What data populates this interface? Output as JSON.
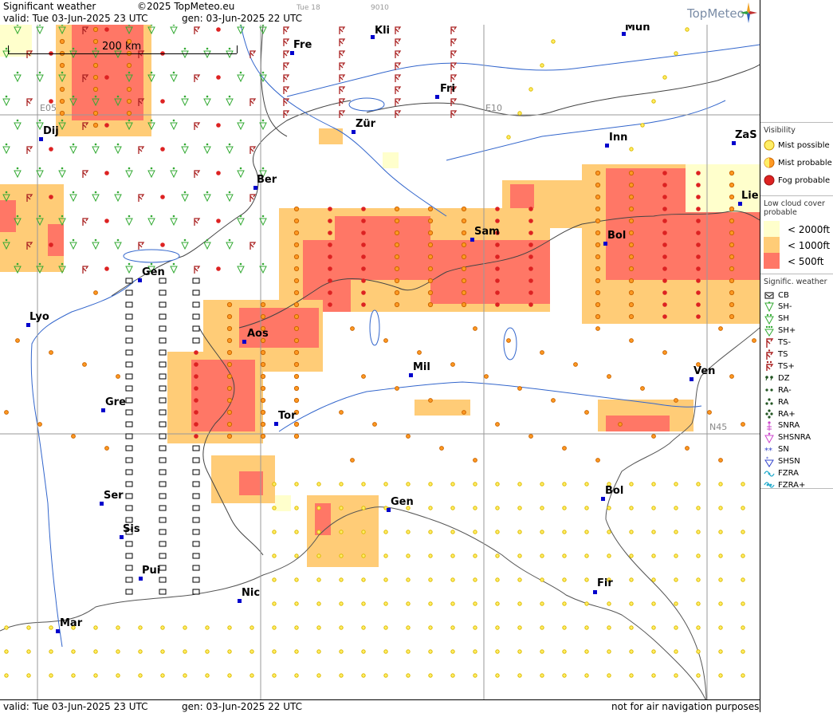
{
  "header": {
    "title": "Significant weather",
    "copyright": "©2025 TopMeteo.eu",
    "valid": "valid:  Tue  03-Jun-2025  23 UTC",
    "gen": "gen: 03-Jun-2025 22 UTC",
    "small1": "Tue 18",
    "small2": "9010",
    "logo": "TopMeteo"
  },
  "footer": {
    "valid": "valid:  Tue  03-Jun-2025  23 UTC",
    "gen": "gen: 03-Jun-2025 22 UTC",
    "note": "not for air navigation purposes"
  },
  "map": {
    "scale_label": "200 km",
    "grid_labels": {
      "e05": "E05",
      "e10": "E10",
      "n45": "N45"
    },
    "cities": [
      {
        "name": "Kli"
      },
      {
        "name": "Mun"
      },
      {
        "name": "Fre"
      },
      {
        "name": "Fri"
      },
      {
        "name": "Dij"
      },
      {
        "name": "Zür"
      },
      {
        "name": "Inn"
      },
      {
        "name": "ZaS"
      },
      {
        "name": "Ber"
      },
      {
        "name": "Lie"
      },
      {
        "name": "Sam"
      },
      {
        "name": "Bol"
      },
      {
        "name": "Gen"
      },
      {
        "name": "Lyo"
      },
      {
        "name": "Aos"
      },
      {
        "name": "Mil"
      },
      {
        "name": "Ven"
      },
      {
        "name": "Gre"
      },
      {
        "name": "Tor"
      },
      {
        "name": "Ser"
      },
      {
        "name": "Gen"
      },
      {
        "name": "Bol"
      },
      {
        "name": "Sis"
      },
      {
        "name": "Pui"
      },
      {
        "name": "Nic"
      },
      {
        "name": "Fir"
      },
      {
        "name": "Mar"
      }
    ]
  },
  "legend": {
    "visibility_title": "Visibility",
    "visibility": [
      {
        "label": "Mist possible",
        "color": "#ffee66"
      },
      {
        "label": "Mist probable",
        "color": "#ff9922"
      },
      {
        "label": "Fog probable",
        "color": "#dd2222"
      }
    ],
    "low_cloud_title": "Low cloud cover probable",
    "low_cloud": [
      {
        "label": "< 2000ft",
        "color": "#ffffcc"
      },
      {
        "label": "< 1000ft",
        "color": "#ffcc77"
      },
      {
        "label": "<   500ft",
        "color": "#ff7766"
      }
    ],
    "signif_title": "Signific. weather",
    "signif": [
      {
        "label": "CB",
        "icon": "cb-icon"
      },
      {
        "label": "SH-",
        "icon": "shower-light-icon"
      },
      {
        "label": "SH",
        "icon": "shower-icon"
      },
      {
        "label": "SH+",
        "icon": "shower-heavy-icon"
      },
      {
        "label": "TS-",
        "icon": "thunder-light-icon"
      },
      {
        "label": "TS",
        "icon": "thunder-icon"
      },
      {
        "label": "TS+",
        "icon": "thunder-heavy-icon"
      },
      {
        "label": "DZ",
        "icon": "drizzle-icon"
      },
      {
        "label": "RA-",
        "icon": "rain-light-icon"
      },
      {
        "label": "RA",
        "icon": "rain-icon"
      },
      {
        "label": "RA+",
        "icon": "rain-heavy-icon"
      },
      {
        "label": "SNRA",
        "icon": "snow-rain-icon"
      },
      {
        "label": "SHSNRA",
        "icon": "shower-snow-rain-icon"
      },
      {
        "label": "SN",
        "icon": "snow-icon"
      },
      {
        "label": "SHSN",
        "icon": "shower-snow-icon"
      },
      {
        "label": "FZRA",
        "icon": "freezing-rain-icon"
      },
      {
        "label": "FZRA+",
        "icon": "freezing-rain-heavy-icon"
      }
    ],
    "colors": {
      "shower": "#33aa33",
      "thunder": "#aa2222",
      "drizzle": "#225522",
      "snow": "#cc44cc",
      "shsn": "#3344cc",
      "fzra": "#22aacc"
    }
  }
}
